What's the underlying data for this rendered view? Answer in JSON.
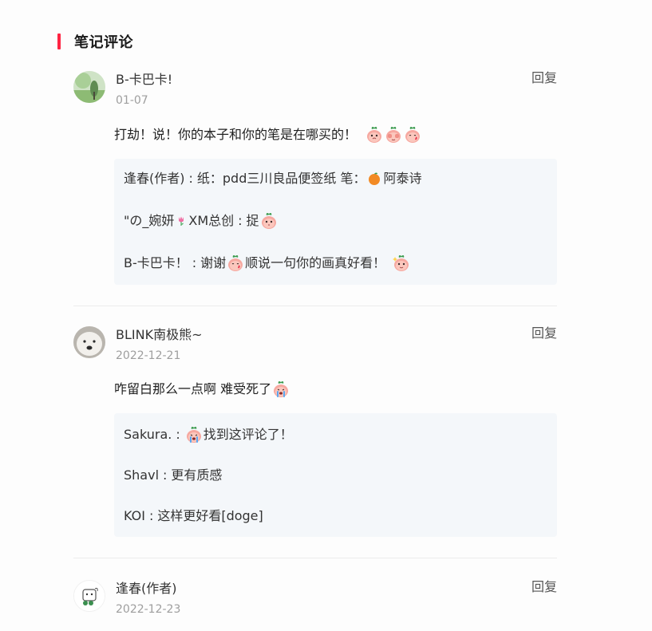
{
  "section": {
    "title": "笔记评论"
  },
  "colors": {
    "accent": "#ff2442",
    "reply_bg": "#f4f7fa",
    "date": "#9e9e9e"
  },
  "comments": [
    {
      "author": "B-卡巴卡!",
      "date": "01-07",
      "reply_label": "回复",
      "content": "打劫！说！你的本子和你的笔是在哪买的！",
      "avatar_icon": "green-landscape-avatar",
      "content_icons": [
        "peach-cry-face-icon",
        "peach-cover-face-icon",
        "peach-blush-face-icon"
      ],
      "replies": [
        {
          "author": "逢春(作者)",
          "text_before": "纸：pdd三川良品便签纸 笔：",
          "icon": "orange-fruit-icon",
          "text_after": "阿泰诗"
        },
        {
          "author": "\"の_婉妍",
          "author_icon": "tulip-icon",
          "author_suffix": "XM总创",
          "text_before": "捉",
          "icon": "peach-face-icon",
          "text_after": ""
        },
        {
          "author": "B-卡巴卡！",
          "text_before": "谢谢",
          "icon": "peach-blush-face-icon",
          "text_after": "顺说一句你的画真好看！",
          "icon2": "peach-sparkle-face-icon"
        }
      ]
    },
    {
      "author": "BLINK南极熊~",
      "date": "2022-12-21",
      "reply_label": "回复",
      "content": "咋留白那么一点啊 难受死了",
      "avatar_icon": "polar-bear-avatar",
      "content_icons": [
        "peach-crying-face-icon"
      ],
      "replies": [
        {
          "author": "Sakura.",
          "text_before": "",
          "icon": "peach-crying-face-icon",
          "text_after": "找到这评论了！"
        },
        {
          "author": "Shavl",
          "text_before": "更有质感",
          "text_after": ""
        },
        {
          "author": "KOI",
          "text_before": "这样更好看[doge]",
          "text_after": ""
        }
      ]
    },
    {
      "author": "逢春(作者)",
      "date": "2022-12-23",
      "reply_label": "回复",
      "avatar_icon": "sketch-character-avatar"
    }
  ]
}
